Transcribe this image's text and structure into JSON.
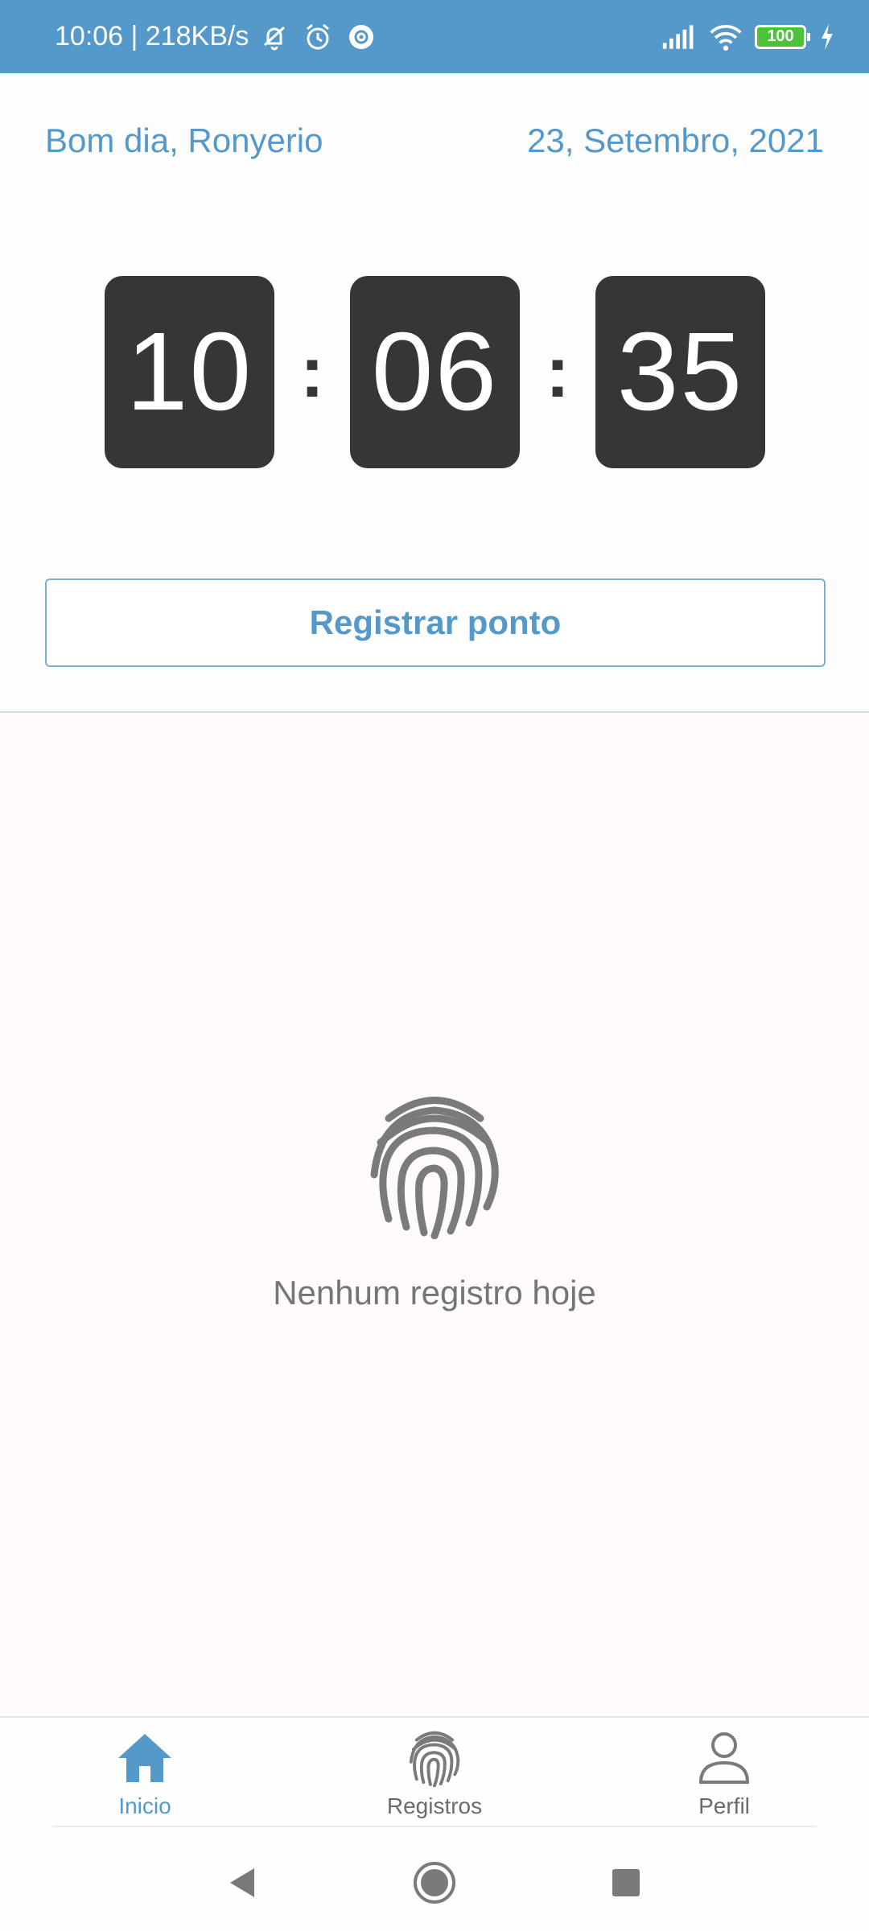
{
  "status_bar": {
    "time_speed": "10:06 | 218KB/s",
    "battery_level": "100",
    "icons": [
      "muted-bell-icon",
      "alarm-icon",
      "gear-icon",
      "signal-icon",
      "wifi-icon",
      "battery-icon",
      "charging-icon"
    ]
  },
  "header": {
    "greeting": "Bom dia, Ronyerio",
    "date": "23, Setembro, 2021"
  },
  "clock": {
    "hours": "10",
    "minutes": "06",
    "seconds": "35",
    "separator": ":"
  },
  "register_button": {
    "label": "Registrar ponto"
  },
  "empty_state": {
    "icon": "fingerprint-icon",
    "text": "Nenhum registro hoje"
  },
  "bottom_nav": {
    "items": [
      {
        "label": "Inicio",
        "icon": "home-icon",
        "active": true
      },
      {
        "label": "Registros",
        "icon": "fingerprint-icon",
        "active": false
      },
      {
        "label": "Perfil",
        "icon": "person-icon",
        "active": false
      }
    ]
  },
  "system_nav": {
    "buttons": [
      "back-icon",
      "home-circle-icon",
      "recents-icon"
    ]
  },
  "colors": {
    "accent": "#5499c9",
    "clock_box": "#363636",
    "background": "#fffbfc",
    "muted_text": "#757575"
  }
}
